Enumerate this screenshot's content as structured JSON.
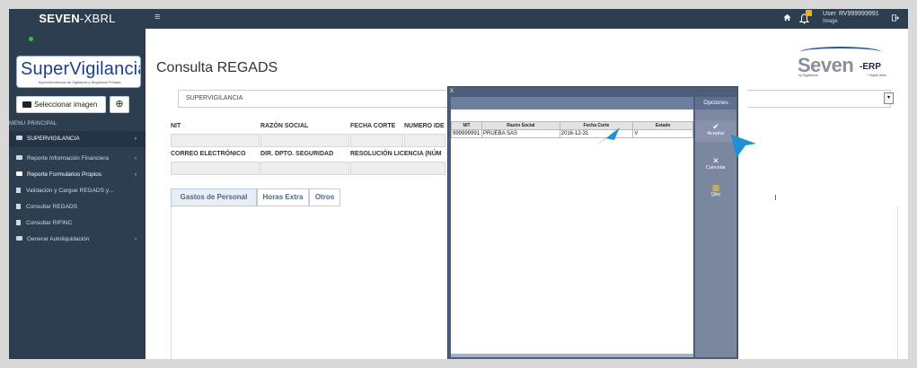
{
  "app": {
    "brand_bold": "SEVEN",
    "brand_rest": "-XBRL",
    "hamburger": "≡",
    "user_label": "User",
    "user_id": "RV999999991",
    "user_image_label": "Image"
  },
  "colors": {
    "navy": "#2d3e50",
    "accent": "#4a6891",
    "modal_frame": "#4c5f7a",
    "options_panel": "#7b869f",
    "pointer": "#1f8fd6"
  },
  "sidebar": {
    "logo_text": "SuperVigilancia",
    "logo_subtitle": "Superintendencia de Vigilancia y Seguridad Privada",
    "select_image_label": "Seleccionar imagen",
    "target_icon": "⊕",
    "menu_title": "MENU PRINCIPAL",
    "items": [
      {
        "label": "SUPERVIGILANCIA",
        "icon": "folder-icon",
        "chevron": "›"
      },
      {
        "label": "Reporte Información Financiera",
        "icon": "folder-icon",
        "chevron": "›"
      },
      {
        "label": "Reporte Formularios Propios",
        "icon": "folder-icon",
        "chevron": "›"
      },
      {
        "label": "Validación y Cargue REGADS y...",
        "icon": "file-icon",
        "chevron": ""
      },
      {
        "label": "Consultar REGADS",
        "icon": "file-icon",
        "chevron": ""
      },
      {
        "label": "Consultar RIFINC",
        "icon": "file-icon",
        "chevron": ""
      },
      {
        "label": "Generar Autoliquidación",
        "icon": "folder-icon",
        "chevron": "›"
      }
    ]
  },
  "main": {
    "page_title": "Consulta REGADS",
    "entity_value": "SUPERVIGILANCIA",
    "select_arrow": "▾",
    "row1_labels": [
      "NIT",
      "RAZÓN SOCIAL",
      "FECHA CORTE",
      "NUMERO IDE"
    ],
    "row2_labels": [
      "CORREO ELECTRÓNICO",
      "DIR. DPTO. SEGURIDAD",
      "RESOLUCIÓN LICENCIA (NÚM"
    ],
    "tabs": [
      {
        "label": "Gastos de Personal",
        "active": true
      },
      {
        "label": "Horas Extra",
        "active": false
      },
      {
        "label": "Otros",
        "active": false
      }
    ]
  },
  "seven_logo": {
    "name": "Seven",
    "suffix": "-ERP",
    "by": "by Digitalware",
    "brand": "+ Digital Ware"
  },
  "modal": {
    "close_label": "x",
    "columns": [
      "NIT",
      "Razón Social",
      "Fecha Corte",
      "Estado"
    ],
    "rows": [
      [
        "999999991",
        "PRUEBA SAS",
        "2016-12-31",
        "V"
      ]
    ],
    "options_title": "Opciones",
    "options": [
      {
        "label": "Aceptar",
        "glyph": "✔",
        "icon": "accept-icon"
      },
      {
        "label": "Cancelar",
        "glyph": "✕",
        "icon": "cancel-icon"
      },
      {
        "label": "Qbe",
        "glyph": "▦",
        "icon": "qbe-icon"
      }
    ]
  }
}
